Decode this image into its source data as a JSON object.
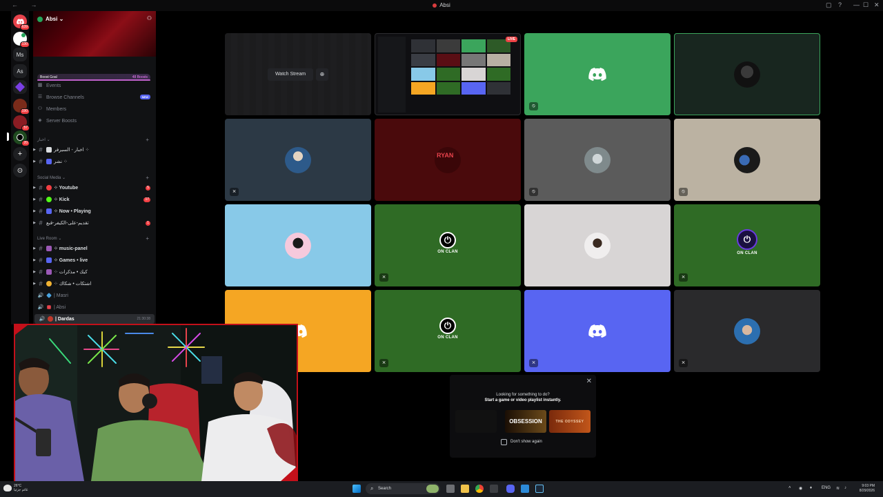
{
  "window": {
    "title": "Absi",
    "nav_symbols": "← →",
    "controls": [
      "▢",
      "?",
      "—",
      "☐",
      "✕"
    ]
  },
  "server_rail": {
    "items": [
      {
        "label": "",
        "badge": "639",
        "color": "#e8434c"
      },
      {
        "label": "",
        "badge": "130",
        "color": "#e8434c"
      },
      {
        "label": "Ms",
        "badge": "",
        "color": "#1e1f22"
      },
      {
        "label": "As",
        "badge": "",
        "color": "#1e1f22"
      },
      {
        "label": "",
        "badge": "",
        "color": "#6a3be0"
      },
      {
        "label": "",
        "badge": "190",
        "color": "#7a2b1a"
      },
      {
        "label": "",
        "badge": "57",
        "color": "#8a1c23"
      },
      {
        "label": "",
        "badge": "20",
        "color": "#1f4a1f"
      },
      {
        "label": "+",
        "badge": "",
        "color": "#1e1f22"
      },
      {
        "label": "⊙",
        "badge": "",
        "color": "#1e1f22"
      }
    ]
  },
  "server": {
    "name": "Absi",
    "chevron": "⌄",
    "boost_goal": "Boost Goal",
    "boost_count": "48 Boosts",
    "menu": [
      {
        "label": "Events",
        "icon": "calendar-icon"
      },
      {
        "label": "Browse Channels",
        "icon": "browse-icon",
        "tag": "NEW"
      },
      {
        "label": "Members",
        "icon": "members-icon"
      },
      {
        "label": "Server Boosts",
        "icon": "boost-icon"
      }
    ]
  },
  "categories": {
    "news": {
      "label": "اخبار ⌄"
    },
    "social": {
      "label": "Social Media ⌄"
    },
    "live": {
      "label": "Live Room ⌄"
    }
  },
  "channels": {
    "news": [
      {
        "label": "اخبار - السيرفر ⁘"
      },
      {
        "label": "نشر ⁘"
      }
    ],
    "social": [
      {
        "label": "⁘ Youtube",
        "count": "5"
      },
      {
        "label": "⁘ Kick",
        "count": "17"
      },
      {
        "label": "⁘ Now • Playing",
        "count": ""
      },
      {
        "label": "تقديم-على-الكيفر-قبع",
        "count": "1"
      }
    ],
    "live_text": [
      {
        "label": "⁘ music-panel"
      },
      {
        "label": "⁘ Games • live"
      },
      {
        "label": "⁘ كيك • مذكرات"
      },
      {
        "label": "⁘ اشتكات • شكاك"
      }
    ],
    "voice": [
      {
        "label": "| Masri"
      },
      {
        "label": "| Absi"
      },
      {
        "label": "| Dardas",
        "time": "21:30:38"
      }
    ]
  },
  "stream": {
    "watch_label": "Watch Stream",
    "live_label": "LIVE",
    "oc_label": "ON CLAN",
    "ryan_label": "RYAN"
  },
  "activity": {
    "title": "Looking for something to do?",
    "subtitle": "Start a game or video playlist instantly.",
    "cards": [
      "",
      "OBSESSION",
      "THE ODYSSEY"
    ],
    "dont_show": "Don't show again",
    "close": "✕"
  },
  "taskbar": {
    "temp": "26°C",
    "weather_desc": "غائم جزئيا",
    "search": "Search",
    "lang": "ENG",
    "time": "9:03 PM",
    "date": "8/29/2026"
  },
  "colors": {
    "discord_blurple": "#5865f2",
    "tile_green": "#3ba55c",
    "tile_darkgreen": "#2f6b25",
    "tile_orange": "#f5a623",
    "tile_lightblue": "#88c9e8",
    "webcam_border": "#c4101a"
  }
}
